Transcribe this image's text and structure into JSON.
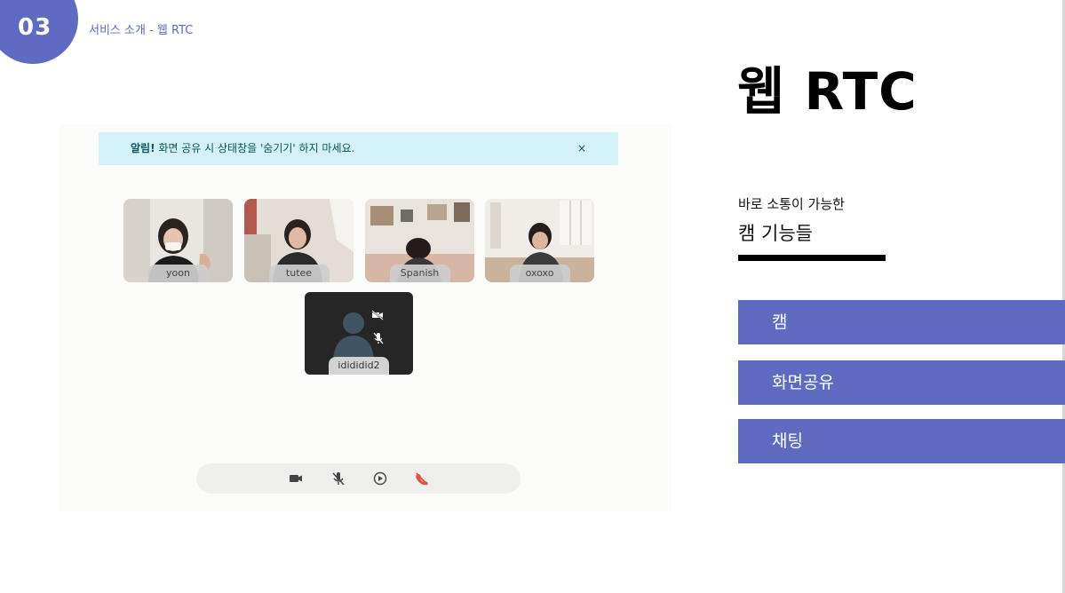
{
  "header": {
    "section_number": "03",
    "breadcrumb": "서비스 소개 - 웹 RTC"
  },
  "slide": {
    "title": "웹 RTC",
    "subtitle": "바로 소통이 가능한",
    "subheading": "캠 기능들",
    "features": [
      "캠",
      "화면공유",
      "채팅"
    ]
  },
  "app": {
    "alert": {
      "label": "알림!",
      "message": " 화면 공유 시 상태창을 '숨기기' 하지 마세요.",
      "close": "×"
    },
    "participants": [
      {
        "name": "yoon"
      },
      {
        "name": "tutee"
      },
      {
        "name": "Spanish"
      },
      {
        "name": "oxoxo"
      }
    ],
    "self": {
      "name": "idididid2"
    },
    "controls": [
      "camera-icon",
      "mic-muted-icon",
      "record-icon",
      "hang-up-icon"
    ]
  },
  "colors": {
    "accent": "#5d6cc1",
    "alert_bg": "#d3f1f7",
    "alert_text": "#0c5460",
    "hangup": "#e0523f"
  }
}
